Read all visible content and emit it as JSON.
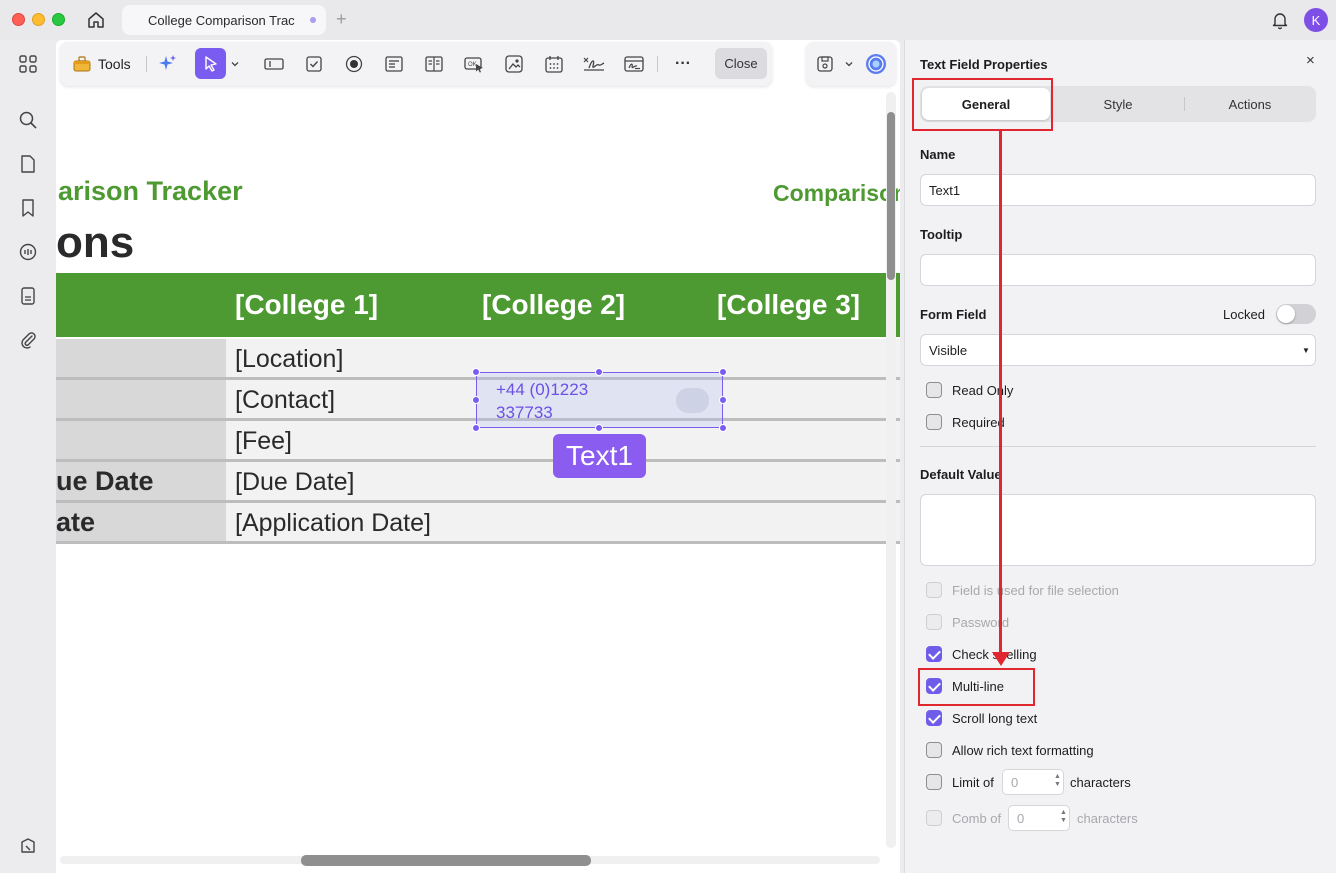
{
  "window": {
    "tab_title": "College Comparison Trac",
    "avatar_initial": "K"
  },
  "toolbar": {
    "tools_label": "Tools",
    "close_label": "Close",
    "more_label": "···"
  },
  "document": {
    "heading_partial": "arison Tracker",
    "heading_right_partial": "Comparison",
    "subheading_partial": "ons",
    "table_headers": [
      "[College 1]",
      "[College 2]",
      "[College 3]"
    ],
    "rows": [
      {
        "label": "",
        "value": "[Location]"
      },
      {
        "label": "",
        "value": "[Contact]"
      },
      {
        "label": "",
        "value": "[Fee]"
      },
      {
        "label": "ue Date",
        "value": "[Due Date]"
      },
      {
        "label": "ate",
        "value": "[Application Date]"
      }
    ],
    "field_value_line1": "+44 (0)1223",
    "field_value_line2": "337733",
    "field_tag": "Text1"
  },
  "panel": {
    "title": "Text Field Properties",
    "close_glyph": "×",
    "tabs": [
      "General",
      "Style",
      "Actions"
    ],
    "name_label": "Name",
    "name_value": "Text1",
    "tooltip_label": "Tooltip",
    "tooltip_value": "",
    "form_field_label": "Form Field",
    "locked_label": "Locked",
    "visibility_value": "Visible",
    "read_only_label": "Read Only",
    "required_label": "Required",
    "default_value_label": "Default Value",
    "file_selection_label": "Field is used for file selection",
    "password_label": "Password",
    "check_spelling_label": "Check spelling",
    "multiline_label": "Multi-line",
    "scroll_label": "Scroll long text",
    "rich_text_label": "Allow rich text formatting",
    "limit_label": "Limit of",
    "limit_value": "0",
    "limit_after": "characters",
    "comb_label": "Comb of",
    "comb_value": "0",
    "comb_after": "characters"
  },
  "colors": {
    "accent": "#7b5cf0",
    "doc_green": "#4e9a32",
    "annotation_red": "#e0262f"
  }
}
